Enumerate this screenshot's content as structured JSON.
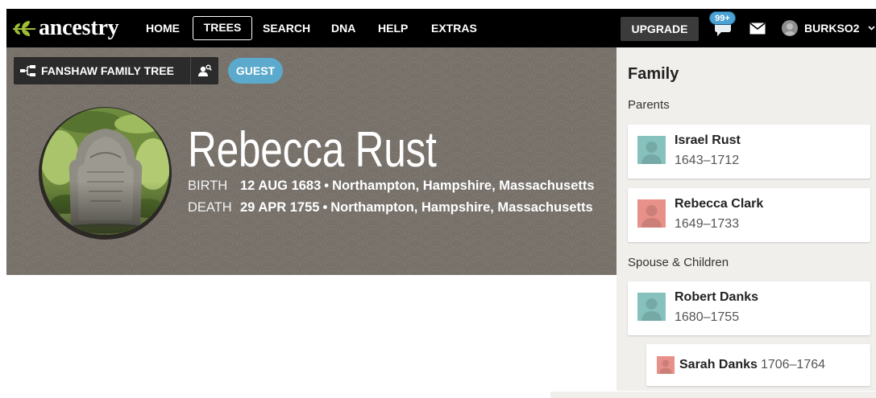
{
  "nav": {
    "logo_text": "ancestry",
    "items": [
      {
        "label": "HOME"
      },
      {
        "label": "TREES",
        "active": true
      },
      {
        "label": "SEARCH"
      },
      {
        "label": "DNA"
      },
      {
        "label": "HELP"
      },
      {
        "label": "EXTRAS"
      }
    ],
    "upgrade_label": "UPGRADE",
    "notification_count": "99+",
    "username": "BURKSO2",
    "icons": {
      "logo": "ancestry-leaf-icon",
      "messages": "chat-bubble-icon",
      "mail": "mail-icon",
      "account": "user-avatar-icon",
      "account_menu": "chevron-down-icon"
    }
  },
  "tree_bar": {
    "tree_name": "FANSHAW FAMILY TREE",
    "access_badge": "GUEST",
    "icons": {
      "tree": "family-tree-icon",
      "find_person": "person-search-icon"
    }
  },
  "person": {
    "name": "Rebecca Rust",
    "birth": {
      "label": "BIRTH",
      "date": "12 AUG 1683",
      "separator": "•",
      "place": "Northampton, Hampshire, Massachusetts"
    },
    "death": {
      "label": "DEATH",
      "date": "29 APR 1755",
      "separator": "•",
      "place": "Northampton, Hampshire, Massachusetts"
    }
  },
  "family": {
    "title": "Family",
    "parents_heading": "Parents",
    "parents": [
      {
        "name": "Israel Rust",
        "dates": "1643–1712",
        "avatar": "male-avatar-icon"
      },
      {
        "name": "Rebecca Clark",
        "dates": "1649–1733",
        "avatar": "female-avatar-icon"
      }
    ],
    "spouse_children_heading": "Spouse & Children",
    "spouses": [
      {
        "name": "Robert Danks",
        "dates": "1680–1755",
        "avatar": "male-avatar-icon"
      }
    ],
    "children": [
      {
        "name": "Sarah Danks",
        "dates": "1706–1764",
        "avatar": "female-avatar-icon"
      }
    ]
  },
  "colors": {
    "nav_bg": "#000000",
    "hero_bg": "#77716a",
    "panel_bg": "#f1efec",
    "guest_badge": "#5ba9cc",
    "notification_badge": "#4ba3d3",
    "upgrade_bg": "#3b3b3b",
    "tree_button_bg": "#2b2b2b",
    "logo_green": "#9dbf35",
    "male_avatar": "#86c1bd",
    "female_avatar": "#e8918a"
  }
}
